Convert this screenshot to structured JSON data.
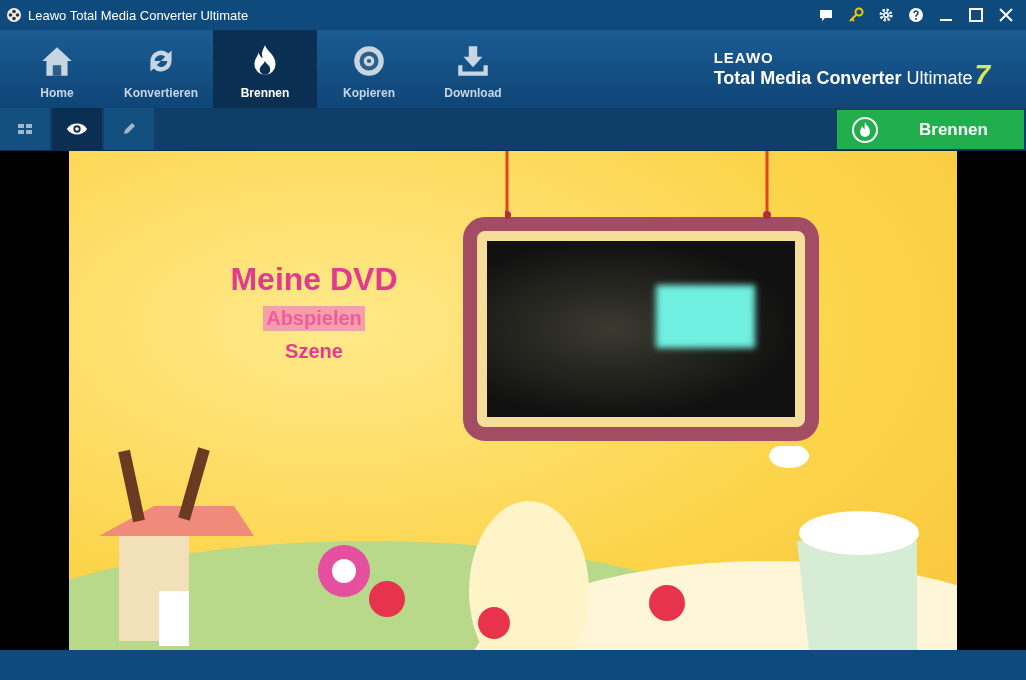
{
  "window": {
    "title": "Leawo Total Media Converter Ultimate"
  },
  "tabs": [
    {
      "label": "Home",
      "selected": false
    },
    {
      "label": "Konvertieren",
      "selected": false
    },
    {
      "label": "Brennen",
      "selected": true
    },
    {
      "label": "Kopieren",
      "selected": false
    },
    {
      "label": "Download",
      "selected": false
    }
  ],
  "logo": {
    "brand": "LEAWO",
    "product": "Total Media Converter",
    "edition": "Ultimate",
    "version": "7"
  },
  "view_modes": [
    {
      "selected": false
    },
    {
      "selected": true
    },
    {
      "selected": false
    }
  ],
  "burn_button": {
    "label": "Brennen"
  },
  "menu_preview": {
    "title": "Meine DVD",
    "items": [
      {
        "label": "Abspielen",
        "selected": true
      },
      {
        "label": "Szene",
        "selected": false
      }
    ]
  }
}
